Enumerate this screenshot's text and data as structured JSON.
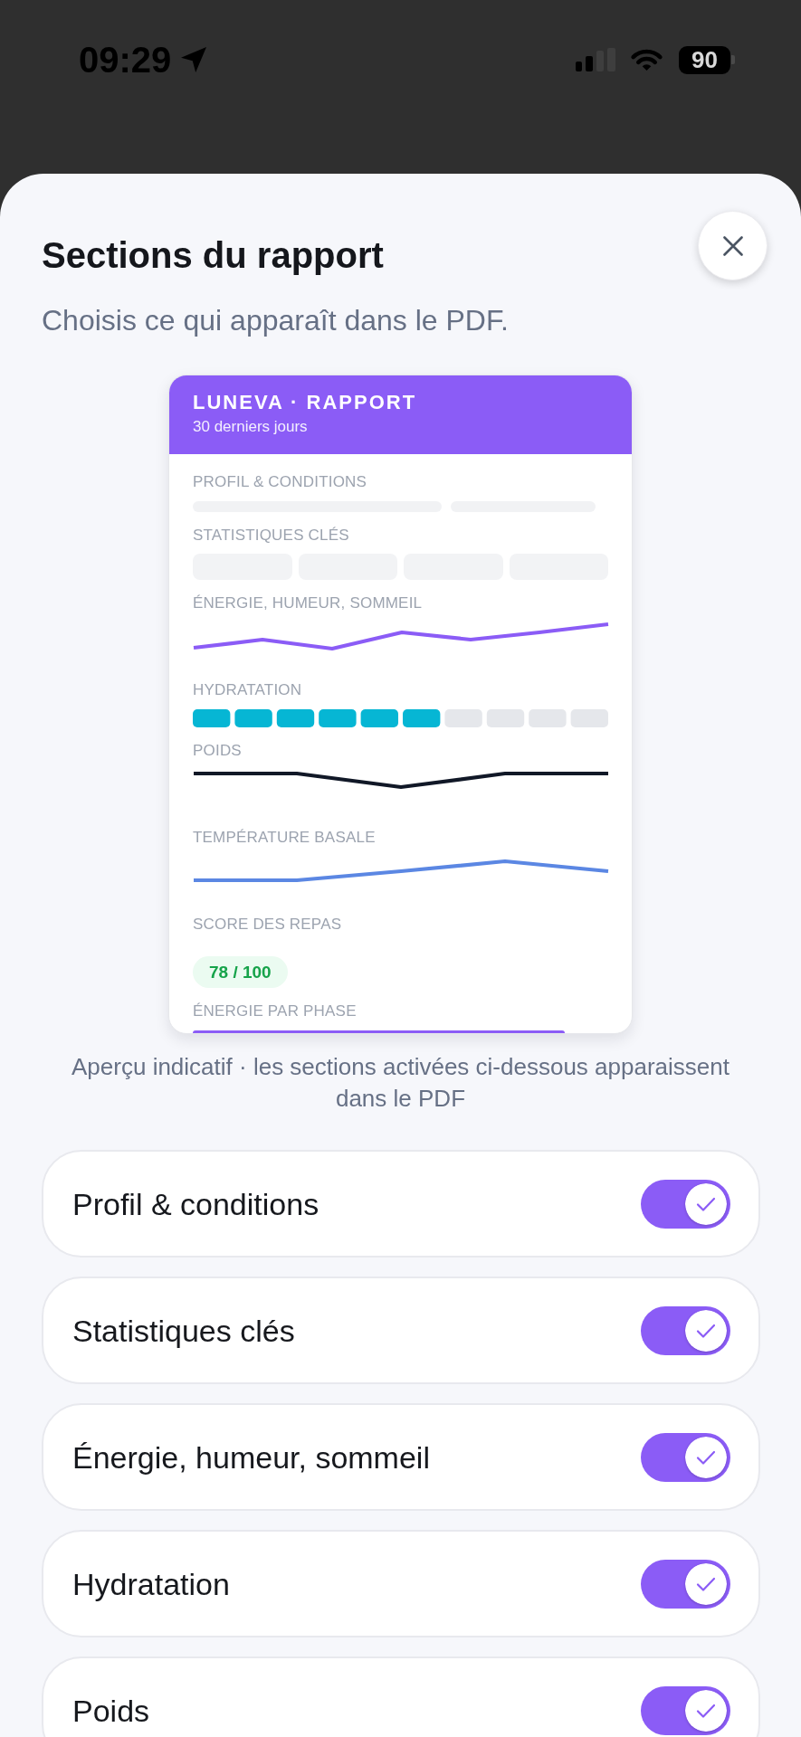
{
  "status_bar": {
    "time": "09:29",
    "battery": "90"
  },
  "sheet": {
    "title": "Sections du rapport",
    "subtitle": "Choisis ce qui apparaît dans le PDF."
  },
  "preview": {
    "brand": "LUNEVA · RAPPORT",
    "period": "30 derniers jours",
    "sections": [
      {
        "kind": "bars",
        "label": "PROFIL & CONDITIONS"
      },
      {
        "kind": "tiles",
        "label": "STATISTIQUES CLÉS"
      },
      {
        "kind": "line",
        "label": "ÉNERGIE, HUMEUR, SOMMEIL",
        "color": "#8b5cf6"
      },
      {
        "kind": "meter",
        "label": "HYDRATATION",
        "level": 0.6
      },
      {
        "kind": "line",
        "label": "POIDS",
        "color": "#111827"
      },
      {
        "kind": "line",
        "label": "TEMPÉRATURE BASALE",
        "color": "#5b87e3"
      },
      {
        "kind": "badge",
        "label": "SCORE DES REPAS",
        "value": "78 / 100"
      },
      {
        "kind": "bar",
        "label": "ÉNERGIE PAR PHASE"
      }
    ]
  },
  "caption": "Aperçu indicatif · les sections activées ci-dessous apparaissent dans le PDF",
  "sections": [
    {
      "label": "Profil & conditions",
      "on": true
    },
    {
      "label": "Statistiques clés",
      "on": true
    },
    {
      "label": "Énergie, humeur, sommeil",
      "on": true
    },
    {
      "label": "Hydratation",
      "on": true
    },
    {
      "label": "Poids",
      "on": true
    }
  ]
}
